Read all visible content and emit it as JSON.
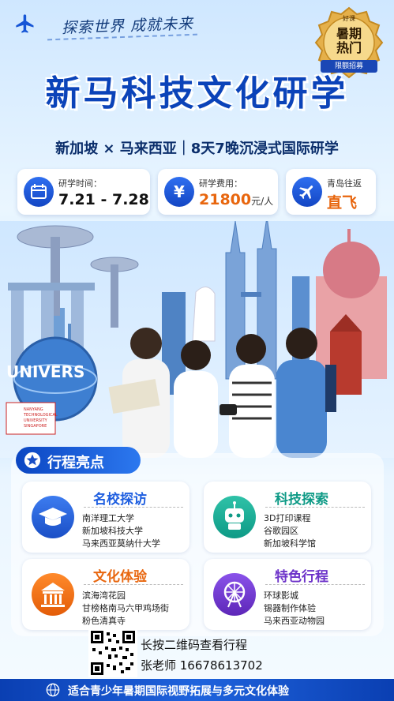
{
  "header": {
    "slogan": "探索世界 成就未来",
    "seal_small": "好课",
    "seal_main_line1": "暑期",
    "seal_main_line2": "热门",
    "seal_ribbon": "限额招募"
  },
  "title": "新马科技文化研学",
  "subtitle": "新加坡 × 马来西亚｜8天7晚沉浸式国际研学",
  "info_cards": [
    {
      "label": "研学时间：",
      "value": "7.21 - 7.28",
      "icon": "calendar-icon"
    },
    {
      "label": "研学费用：",
      "value": "21800",
      "unit": "元/人",
      "icon": "yen-icon"
    },
    {
      "label": "青岛往返",
      "value": "直飞",
      "icon": "airplane-icon"
    }
  ],
  "scene": {
    "globe_text": "UNIVERS",
    "sign_lines": [
      "NANYANG",
      "TECHNOLOGICAL",
      "UNIVERSITY",
      "SINGAPORE"
    ]
  },
  "highlights": {
    "heading": "行程亮点",
    "features": [
      {
        "title": "名校探访",
        "items": [
          "南洋理工大学",
          "新加坡科技大学",
          "马来西亚莫纳什大学"
        ],
        "color": "#1f5fe0",
        "icon": "graduation-cap-icon"
      },
      {
        "title": "科技探索",
        "items": [
          "3D打印课程",
          "谷歌园区",
          "新加坡科学馆"
        ],
        "color": "#0e9a86",
        "icon": "robot-icon"
      },
      {
        "title": "文化体验",
        "items": [
          "滨海湾花园",
          "甘榜格南马六甲鸡场街",
          "粉色清真寺"
        ],
        "color": "#e8660e",
        "icon": "temple-icon"
      },
      {
        "title": "特色行程",
        "items": [
          "环球影城",
          "锡器制作体验",
          "马来西亚动物园"
        ],
        "color": "#6d33c9",
        "icon": "ferris-wheel-icon"
      }
    ]
  },
  "contact": {
    "qr_hint": "长按二维码查看行程",
    "name_phone": "张老师 16678613702"
  },
  "footer": "适合青少年暑期国际视野拓展与多元文化体验",
  "colors": {
    "primary": "#0b43b9",
    "accent_orange": "#e8660e",
    "teal": "#0e9a86",
    "purple": "#6d33c9"
  }
}
